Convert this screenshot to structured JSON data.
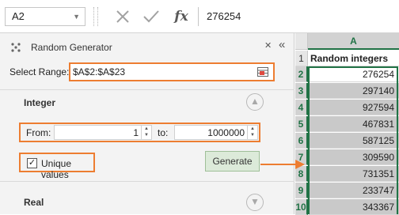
{
  "formula_bar": {
    "name_box": "A2",
    "cancel_icon": "cancel-x-icon",
    "enter_icon": "checkmark-icon",
    "fx_label": "fx",
    "formula_value": "276254"
  },
  "pane": {
    "title": "Random Generator",
    "select_range_label": "Select Range:",
    "select_range_value": "$A$2:$A$23",
    "integer_section": "Integer",
    "from_label": "From:",
    "from_value": "1",
    "to_label": "to:",
    "to_value": "1000000",
    "unique_label": "Unique values",
    "unique_checked": true,
    "generate_label": "Generate",
    "real_section": "Real"
  },
  "sheet": {
    "column": "A",
    "header_row": {
      "row": "1",
      "text": "Random integers"
    },
    "rows": [
      {
        "row": "2",
        "value": "276254"
      },
      {
        "row": "3",
        "value": "297140"
      },
      {
        "row": "4",
        "value": "927594"
      },
      {
        "row": "5",
        "value": "467831"
      },
      {
        "row": "6",
        "value": "587125"
      },
      {
        "row": "7",
        "value": "309590"
      },
      {
        "row": "8",
        "value": "731351"
      },
      {
        "row": "9",
        "value": "233747"
      },
      {
        "row": "10",
        "value": "343367"
      }
    ]
  },
  "colors": {
    "highlight": "#ed7d31",
    "excel_green": "#217346",
    "generate_bg": "#dcead9"
  }
}
